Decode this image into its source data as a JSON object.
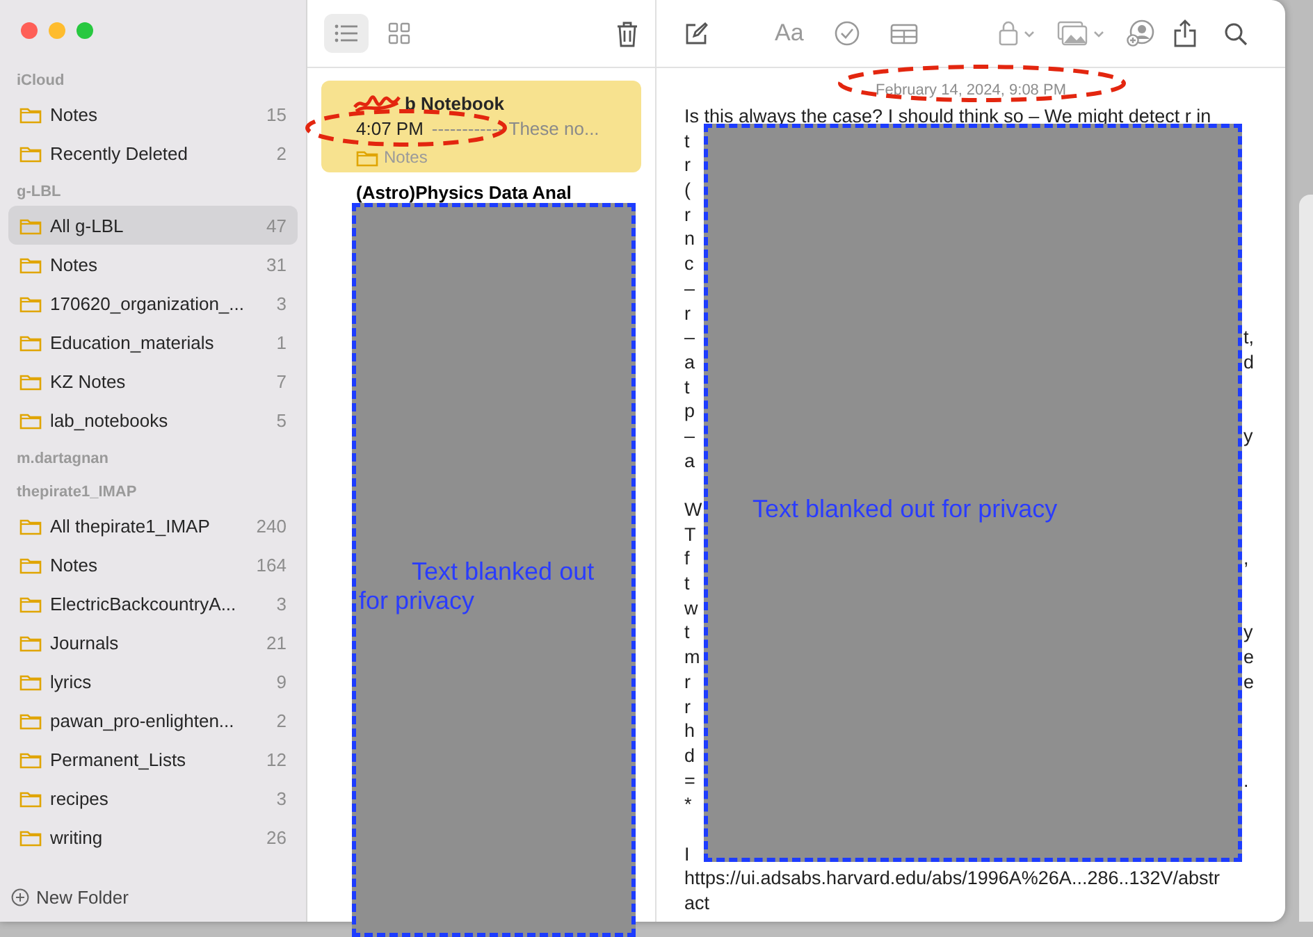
{
  "sidebar": {
    "sections": [
      {
        "title": "iCloud",
        "items": [
          {
            "name": "Notes",
            "count": "15",
            "selected": false
          },
          {
            "name": "Recently Deleted",
            "count": "2",
            "selected": false
          }
        ]
      },
      {
        "title": "g-LBL",
        "items": [
          {
            "name": "All g-LBL",
            "count": "47",
            "selected": true
          },
          {
            "name": "Notes",
            "count": "31",
            "selected": false
          },
          {
            "name": "170620_organization_...",
            "count": "3",
            "selected": false
          },
          {
            "name": "Education_materials",
            "count": "1",
            "selected": false
          },
          {
            "name": "KZ Notes",
            "count": "7",
            "selected": false
          },
          {
            "name": "lab_notebooks",
            "count": "5",
            "selected": false
          }
        ]
      },
      {
        "title": "m.dartagnan"
      },
      {
        "title": "thepirate1_IMAP",
        "items": [
          {
            "name": "All thepirate1_IMAP",
            "count": "240",
            "selected": false
          },
          {
            "name": "Notes",
            "count": "164",
            "selected": false
          },
          {
            "name": "ElectricBackcountryA...",
            "count": "3",
            "selected": false
          },
          {
            "name": "Journals",
            "count": "21",
            "selected": false
          },
          {
            "name": "lyrics",
            "count": "9",
            "selected": false
          },
          {
            "name": "pawan_pro-enlighten...",
            "count": "2",
            "selected": false
          },
          {
            "name": "Permanent_Lists",
            "count": "12",
            "selected": false
          },
          {
            "name": "recipes",
            "count": "3",
            "selected": false
          },
          {
            "name": "writing",
            "count": "26",
            "selected": false
          }
        ]
      }
    ],
    "new_folder": "New Folder"
  },
  "toolbar": {
    "view_buttons": [
      {
        "kind": "list",
        "selected": true
      },
      {
        "kind": "grid",
        "selected": false
      }
    ],
    "format_label": "Aa"
  },
  "note_list": {
    "notes": [
      {
        "title": "b Notebook",
        "scribbled": true,
        "time": "4:07 PM",
        "preview": "------------ These no...",
        "folder": "Notes",
        "selected": true
      },
      {
        "title": "(Astro)Physics Data Anal",
        "selected": false
      }
    ]
  },
  "note": {
    "date": "February 14, 2024, 9:08 PM",
    "lines": [
      {
        "text": "Is this always the case? I should think so – We might detect r  in"
      },
      {
        "left": "t"
      },
      {
        "left": "r"
      },
      {
        "left": "("
      },
      {
        "left": "r"
      },
      {
        "left": "n"
      },
      {
        "left": "c"
      },
      {
        "left": "–"
      },
      {
        "left": "r"
      },
      {
        "left": "–",
        "right": "t,"
      },
      {
        "left": "a",
        "right": "d"
      },
      {
        "left": "t"
      },
      {
        "left": "p"
      },
      {
        "left": "–",
        "right": "y"
      },
      {
        "left": "a"
      },
      {
        "blank": true
      },
      {
        "left": "W"
      },
      {
        "left": "T"
      },
      {
        "left": "f",
        "right": ","
      },
      {
        "left": "t"
      },
      {
        "left": "w"
      },
      {
        "left": "t",
        "right": "y"
      },
      {
        "left": "m",
        "right": "e"
      },
      {
        "left": "r",
        "right": "e"
      },
      {
        "left": "r"
      },
      {
        "left": "h"
      },
      {
        "left": "d"
      },
      {
        "left": "=",
        "right": "."
      },
      {
        "left": "*"
      },
      {
        "blank": true
      },
      {
        "left": "I"
      },
      {
        "text": "https://ui.adsabs.harvard.edu/abs/1996A%26A...286..132V/abstr"
      },
      {
        "text": "act"
      }
    ]
  },
  "redactions": [
    {
      "text": "Text blanked out for privacy"
    },
    {
      "text": "Text blanked out for privacy"
    }
  ]
}
